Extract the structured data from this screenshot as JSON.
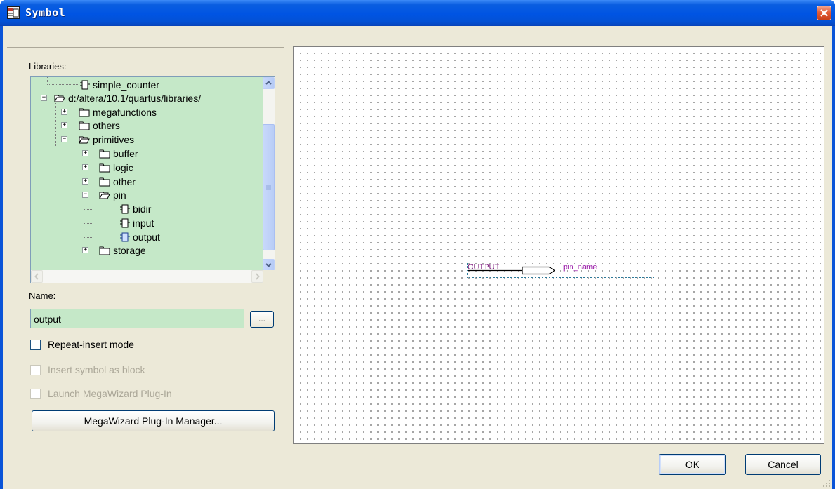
{
  "window": {
    "title": "Symbol"
  },
  "libraries": {
    "label": "Libraries:",
    "tree": [
      {
        "label": "simple_counter",
        "icon": "symbol-icon"
      },
      {
        "label": "d:/altera/10.1/quartus/libraries/",
        "icon": "folder-open-icon",
        "toggle": "−"
      },
      {
        "label": "megafunctions",
        "icon": "folder-icon",
        "toggle": "+"
      },
      {
        "label": "others",
        "icon": "folder-icon",
        "toggle": "+"
      },
      {
        "label": "primitives",
        "icon": "folder-open-icon",
        "toggle": "−"
      },
      {
        "label": "buffer",
        "icon": "folder-icon",
        "toggle": "+"
      },
      {
        "label": "logic",
        "icon": "folder-icon",
        "toggle": "+"
      },
      {
        "label": "other",
        "icon": "folder-icon",
        "toggle": "+"
      },
      {
        "label": "pin",
        "icon": "folder-open-icon",
        "toggle": "−"
      },
      {
        "label": "bidir",
        "icon": "symbol-icon"
      },
      {
        "label": "input",
        "icon": "symbol-icon"
      },
      {
        "label": "output",
        "icon": "symbol-icon",
        "selected": true
      },
      {
        "label": "storage",
        "icon": "folder-icon",
        "toggle": "+"
      }
    ]
  },
  "name": {
    "label": "Name:",
    "value": "output",
    "browse_label": "..."
  },
  "options": {
    "repeat_insert": {
      "label": "Repeat-insert mode",
      "checked": false,
      "enabled": true
    },
    "insert_as_block": {
      "label": "Insert symbol as block",
      "checked": false,
      "enabled": false
    },
    "launch_megawizard": {
      "label": "Launch MegaWizard Plug-In",
      "checked": false,
      "enabled": false
    }
  },
  "megawizard_button": "MegaWizard Plug-In Manager...",
  "preview": {
    "symbol_type": "OUTPUT",
    "pin_name": "pin_name"
  },
  "buttons": {
    "ok": "OK",
    "cancel": "Cancel"
  },
  "colors": {
    "titlebar": "#0054e3",
    "field_bg": "#c5e8c8",
    "dialog_bg": "#ece9d8",
    "close": "#e35b36"
  }
}
